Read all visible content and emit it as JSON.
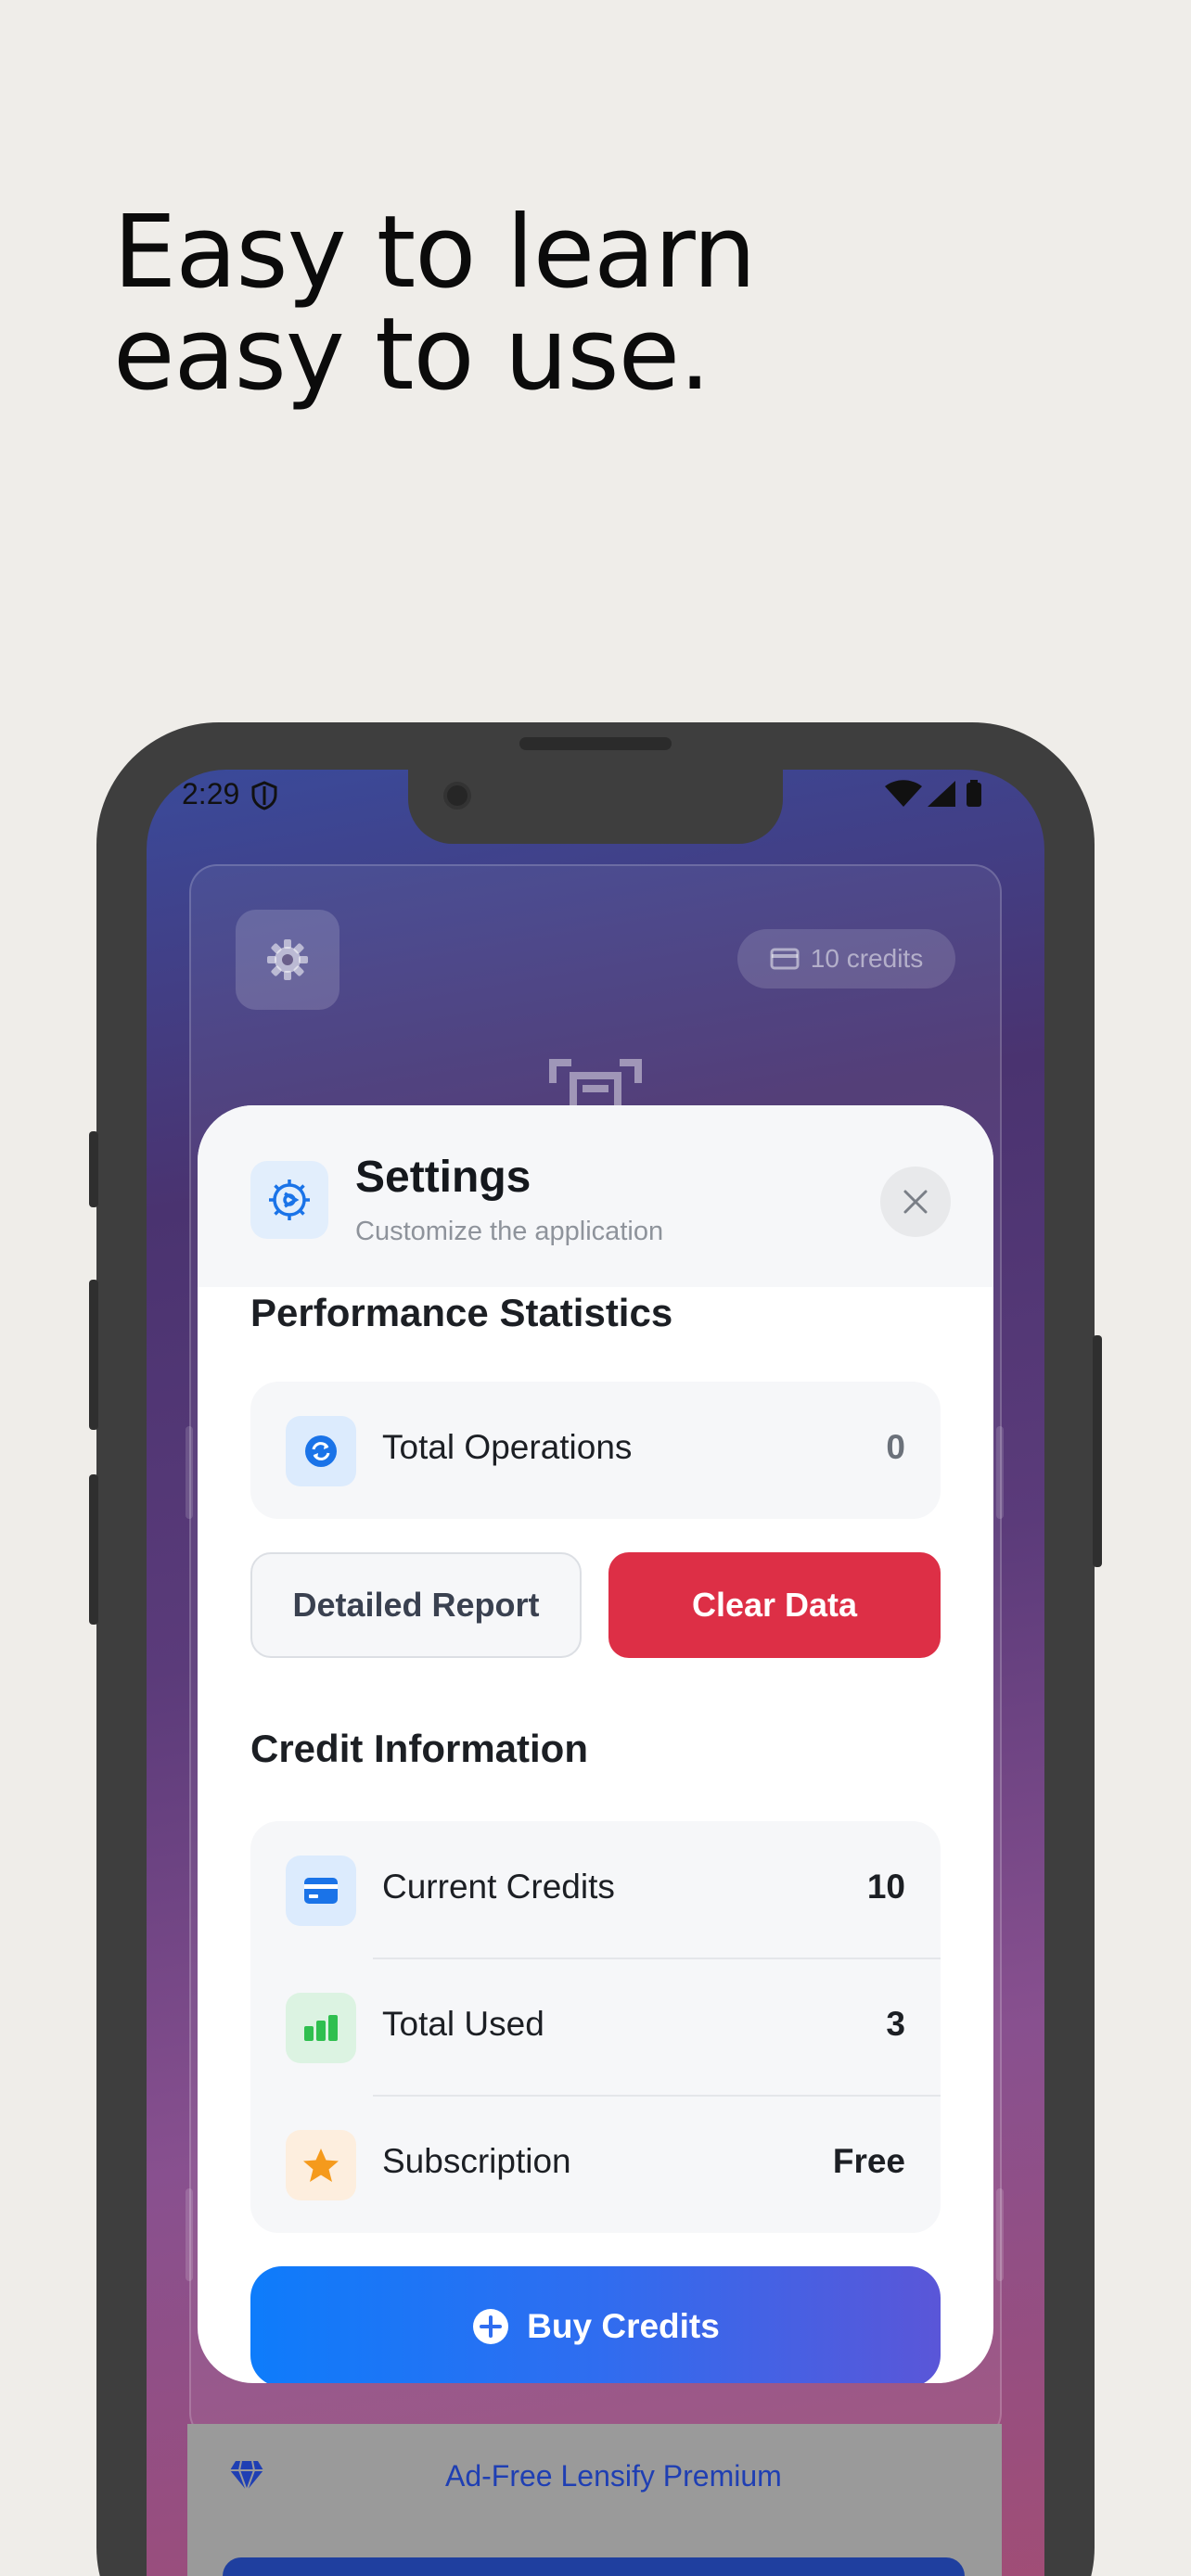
{
  "headline": {
    "line1": "Easy to learn",
    "line2": "easy to use."
  },
  "status_bar": {
    "time": "2:29"
  },
  "background_app": {
    "credits_badge": "10 credits"
  },
  "settings": {
    "title": "Settings",
    "subtitle": "Customize the application",
    "performance": {
      "title": "Performance Statistics",
      "rows": [
        {
          "label": "Total Operations",
          "value": "0",
          "icon": "refresh-icon"
        }
      ]
    },
    "buttons": {
      "report": "Detailed Report",
      "clear": "Clear Data"
    },
    "credits": {
      "title": "Credit Information",
      "rows": [
        {
          "label": "Current Credits",
          "value": "10",
          "icon": "credit-card-icon"
        },
        {
          "label": "Total Used",
          "value": "3",
          "icon": "bar-chart-icon"
        },
        {
          "label": "Subscription",
          "value": "Free",
          "icon": "star-icon"
        }
      ]
    },
    "buy_button": "Buy Credits"
  },
  "premium": {
    "label": "Ad-Free Lensify Premium"
  },
  "colors": {
    "accent_blue": "#0e7cfb",
    "danger_red": "#dd2f46",
    "success_green": "#2fbf4f",
    "warning_orange": "#f59a1c",
    "premium_blue": "#1f3fb3"
  }
}
